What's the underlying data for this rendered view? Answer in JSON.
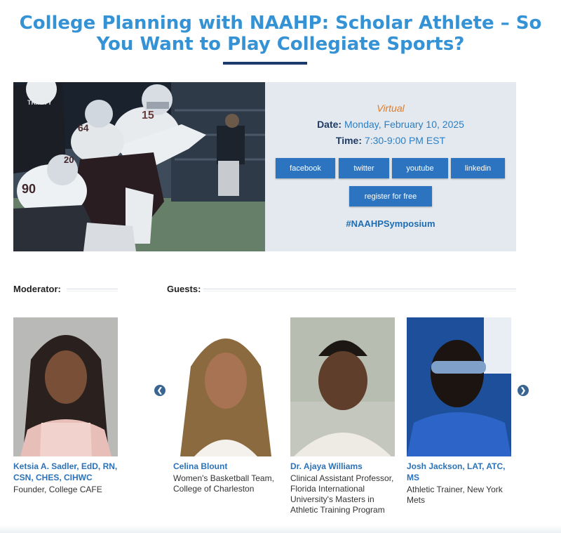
{
  "page": {
    "title": "College Planning with NAAHP: Scholar Athlete – So You Want to Play Collegiate Sports?"
  },
  "event": {
    "format": "Virtual",
    "date_label": "Date:",
    "date_value": "Monday, February 10, 2025",
    "time_label": "Time:",
    "time_value": "7:30-9:00 PM EST",
    "share_buttons": [
      "facebook",
      "twitter",
      "youtube",
      "linkedin"
    ],
    "register_label": "register for free",
    "hashtag": "#NAAHPSymposium"
  },
  "hero_image": {
    "jersey_numbers": [
      "15",
      "64",
      "90",
      "20"
    ],
    "team_text": "TRINITY"
  },
  "moderator": {
    "section_label": "Moderator:",
    "name": "Ketsia A. Sadler, EdD, RN, CSN, CHES, CIHWC",
    "role": "Founder, College CAFE"
  },
  "guests": {
    "section_label": "Guests:",
    "people": [
      {
        "name": "Celina Blount",
        "role": "Women's Basketball Team, College of Charleston"
      },
      {
        "name": "Dr. Ajaya Williams",
        "role": "Clinical Assistant Professor, Florida International University's Masters in Athletic Training Program"
      },
      {
        "name": "Josh Jackson, LAT, ATC, MS",
        "role": "Athletic Trainer, New York Mets"
      }
    ]
  },
  "colors": {
    "title_blue": "#3592d5",
    "button_blue": "#2c74c0",
    "accent_orange": "#e07b27",
    "navy": "#1f3a63"
  },
  "icons": {
    "carousel_prev": "chevron-left-icon",
    "carousel_next": "chevron-right-icon"
  }
}
